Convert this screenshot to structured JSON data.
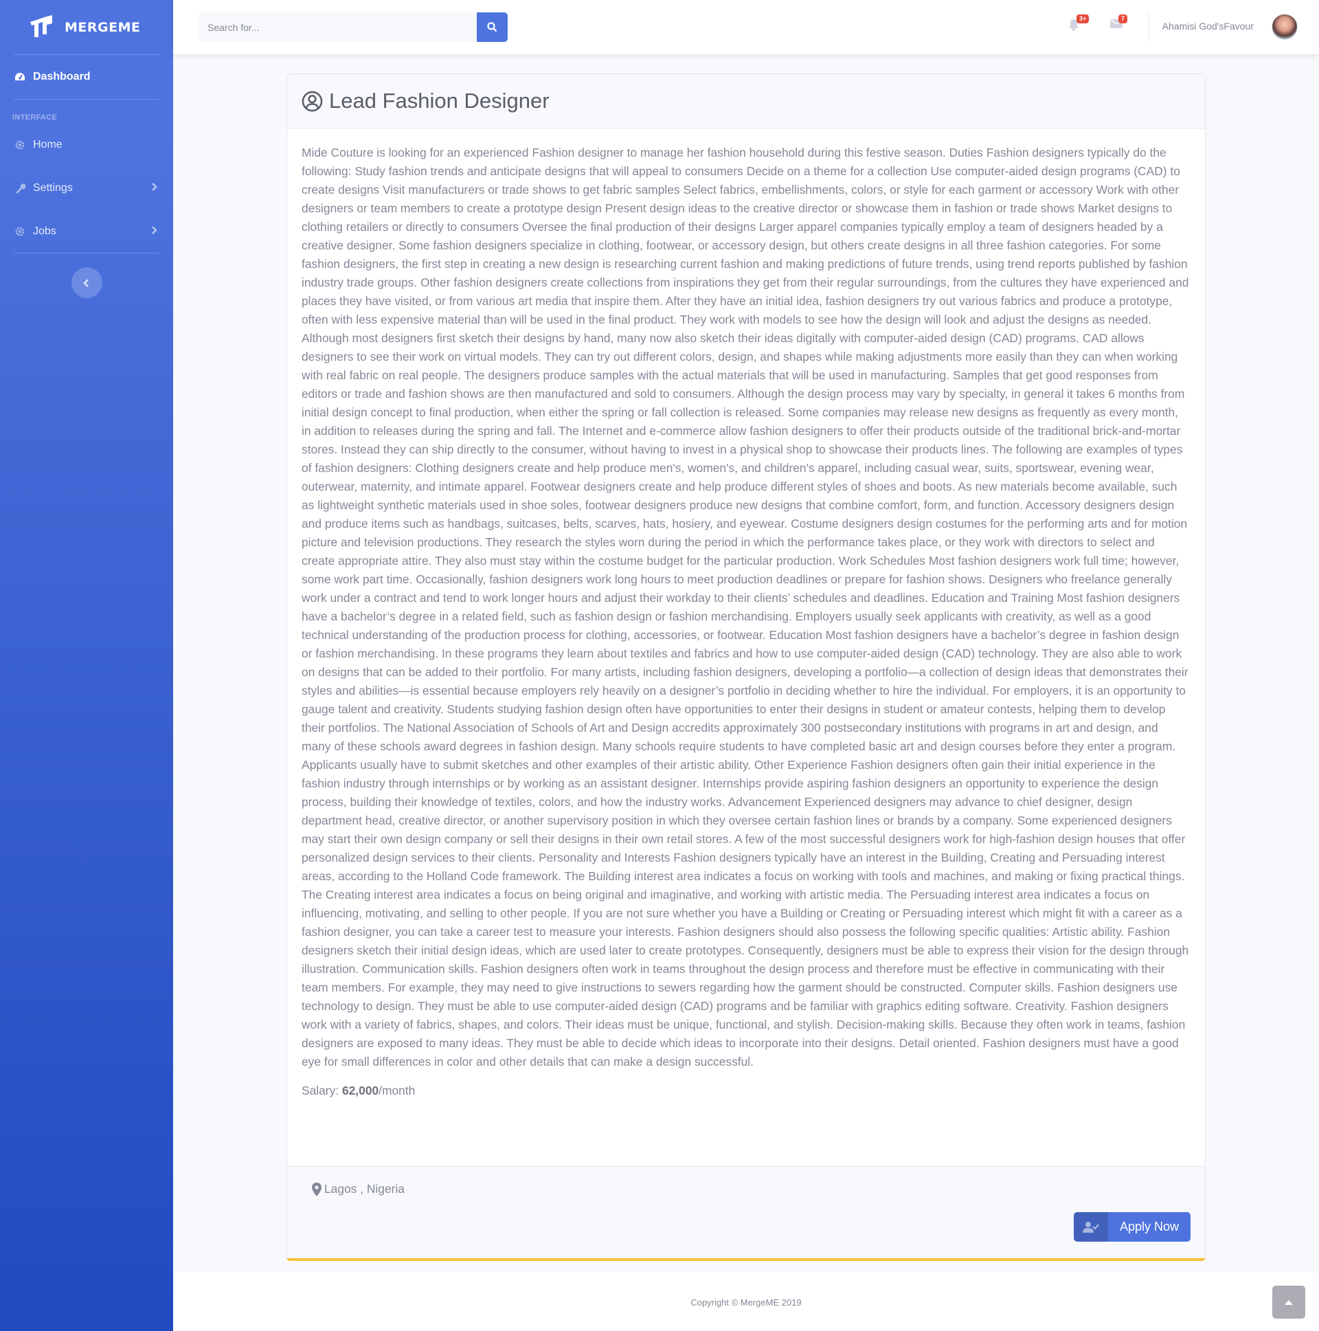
{
  "brand": {
    "name": "MERGEME"
  },
  "sidebar": {
    "dashboard_label": "Dashboard",
    "heading": "INTERFACE",
    "items": [
      {
        "label": "Home",
        "icon": "gear-icon"
      },
      {
        "label": "Settings",
        "icon": "wrench-icon"
      },
      {
        "label": "Jobs",
        "icon": "gear-icon"
      }
    ]
  },
  "topbar": {
    "search_placeholder": "Search for...",
    "alerts_badge": "3+",
    "messages_badge": "7",
    "user_name": "Ahamisi God'sFavour"
  },
  "job": {
    "title": "Lead Fashion Designer",
    "description": "Mide Couture is looking for an experienced Fashion designer to manage her fashion household during this festive season. Duties Fashion designers typically do the following: Study fashion trends and anticipate designs that will appeal to consumers Decide on a theme for a collection Use computer-aided design programs (CAD) to create designs Visit manufacturers or trade shows to get fabric samples Select fabrics, embellishments, colors, or style for each garment or accessory Work with other designers or team members to create a prototype design Present design ideas to the creative director or showcase them in fashion or trade shows Market designs to clothing retailers or directly to consumers Oversee the final production of their designs Larger apparel companies typically employ a team of designers headed by a creative designer. Some fashion designers specialize in clothing, footwear, or accessory design, but others create designs in all three fashion categories. For some fashion designers, the first step in creating a new design is researching current fashion and making predictions of future trends, using trend reports published by fashion industry trade groups. Other fashion designers create collections from inspirations they get from their regular surroundings, from the cultures they have experienced and places they have visited, or from various art media that inspire them. After they have an initial idea, fashion designers try out various fabrics and produce a prototype, often with less expensive material than will be used in the final product. They work with models to see how the design will look and adjust the designs as needed. Although most designers first sketch their designs by hand, many now also sketch their ideas digitally with computer-aided design (CAD) programs. CAD allows designers to see their work on virtual models. They can try out different colors, design, and shapes while making adjustments more easily than they can when working with real fabric on real people. The designers produce samples with the actual materials that will be used in manufacturing. Samples that get good responses from editors or trade and fashion shows are then manufactured and sold to consumers. Although the design process may vary by specialty, in general it takes 6 months from initial design concept to final production, when either the spring or fall collection is released. Some companies may release new designs as frequently as every month, in addition to releases during the spring and fall. The Internet and e-commerce allow fashion designers to offer their products outside of the traditional brick-and-mortar stores. Instead they can ship directly to the consumer, without having to invest in a physical shop to showcase their products lines. The following are examples of types of fashion designers: Clothing designers create and help produce men's, women's, and children's apparel, including casual wear, suits, sportswear, evening wear, outerwear, maternity, and intimate apparel. Footwear designers create and help produce different styles of shoes and boots. As new materials become available, such as lightweight synthetic materials used in shoe soles, footwear designers produce new designs that combine comfort, form, and function. Accessory designers design and produce items such as handbags, suitcases, belts, scarves, hats, hosiery, and eyewear. Costume designers design costumes for the performing arts and for motion picture and television productions. They research the styles worn during the period in which the performance takes place, or they work with directors to select and create appropriate attire. They also must stay within the costume budget for the particular production. Work Schedules Most fashion designers work full time; however, some work part time. Occasionally, fashion designers work long hours to meet production deadlines or prepare for fashion shows. Designers who freelance generally work under a contract and tend to work longer hours and adjust their workday to their clients’ schedules and deadlines. Education and Training Most fashion designers have a bachelor’s degree in a related field, such as fashion design or fashion merchandising. Employers usually seek applicants with creativity, as well as a good technical understanding of the production process for clothing, accessories, or footwear. Education Most fashion designers have a bachelor’s degree in fashion design or fashion merchandising. In these programs they learn about textiles and fabrics and how to use computer-aided design (CAD) technology. They are also able to work on designs that can be added to their portfolio. For many artists, including fashion designers, developing a portfolio—a collection of design ideas that demonstrates their styles and abilities—is essential because employers rely heavily on a designer’s portfolio in deciding whether to hire the individual. For employers, it is an opportunity to gauge talent and creativity. Students studying fashion design often have opportunities to enter their designs in student or amateur contests, helping them to develop their portfolios. The National Association of Schools of Art and Design accredits approximately 300 postsecondary institutions with programs in art and design, and many of these schools award degrees in fashion design. Many schools require students to have completed basic art and design courses before they enter a program. Applicants usually have to submit sketches and other examples of their artistic ability. Other Experience Fashion designers often gain their initial experience in the fashion industry through internships or by working as an assistant designer. Internships provide aspiring fashion designers an opportunity to experience the design process, building their knowledge of textiles, colors, and how the industry works. Advancement Experienced designers may advance to chief designer, design department head, creative director, or another supervisory position in which they oversee certain fashion lines or brands by a company. Some experienced designers may start their own design company or sell their designs in their own retail stores. A few of the most successful designers work for high-fashion design houses that offer personalized design services to their clients. Personality and Interests Fashion designers typically have an interest in the Building, Creating and Persuading interest areas, according to the Holland Code framework. The Building interest area indicates a focus on working with tools and machines, and making or fixing practical things. The Creating interest area indicates a focus on being original and imaginative, and working with artistic media. The Persuading interest area indicates a focus on influencing, motivating, and selling to other people. If you are not sure whether you have a Building or Creating or Persuading interest which might fit with a career as a fashion designer, you can take a career test to measure your interests. Fashion designers should also possess the following specific qualities: Artistic ability. Fashion designers sketch their initial design ideas, which are used later to create prototypes. Consequently, designers must be able to express their vision for the design through illustration. Communication skills. Fashion designers often work in teams throughout the design process and therefore must be effective in communicating with their team members. For example, they may need to give instructions to sewers regarding how the garment should be constructed. Computer skills. Fashion designers use technology to design. They must be able to use computer-aided design (CAD) programs and be familiar with graphics editing software. Creativity. Fashion designers work with a variety of fabrics, shapes, and colors. Their ideas must be unique, functional, and stylish. Decision-making skills. Because they often work in teams, fashion designers are exposed to many ideas. They must be able to decide which ideas to incorporate into their designs. Detail oriented. Fashion designers must have a good eye for small differences in color and other details that can make a design successful.",
    "salary_label": "Salary: ",
    "salary_value": "62,000",
    "salary_unit": "/month",
    "location": "Lagos , Nigeria",
    "apply_label": "Apply Now"
  },
  "footer": {
    "copyright": "Copyright © MergeME 2019"
  },
  "colors": {
    "primary": "#4e73df",
    "accent_border": "#f6c23e",
    "badge": "#e74a3b"
  }
}
